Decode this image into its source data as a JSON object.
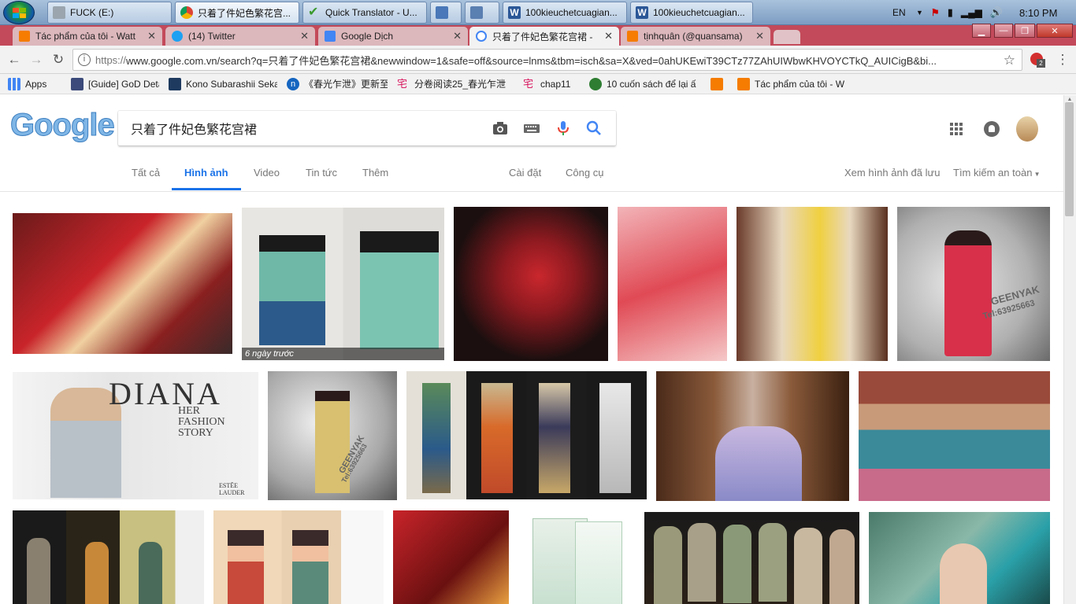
{
  "taskbar": {
    "items": [
      {
        "label": "FUCK (E:)",
        "icon": "drive-icon"
      },
      {
        "label": "只着了件妃色繁花宫...",
        "icon": "chrome-icon"
      },
      {
        "label": "Quick Translator - U...",
        "icon": "check-icon"
      },
      {
        "label": "",
        "icon": "keyboard-icon"
      },
      {
        "label": "",
        "icon": "network-window-icon"
      },
      {
        "label": "100kieuchetcuagian...",
        "icon": "word-icon"
      },
      {
        "label": "100kieuchetcuagian...",
        "icon": "word-icon"
      }
    ],
    "lang": "EN",
    "time": "8:10 PM"
  },
  "tabs": [
    {
      "title": "Tác phẩm của tôi - Watt",
      "icon": "wattpad-icon"
    },
    {
      "title": "(14) Twitter",
      "icon": "twitter-icon"
    },
    {
      "title": "Google Dịch",
      "icon": "google-translate-icon"
    },
    {
      "title": "只着了件妃色繁花宫裙 -",
      "icon": "google-icon"
    },
    {
      "title": "tịnhquân (@quansama)",
      "icon": "wattpad-icon"
    }
  ],
  "toolbar": {
    "url_scheme": "https://",
    "url_rest": "www.google.com.vn/search?q=只着了件妃色繁花宫裙&newwindow=1&safe=off&source=lnms&tbm=isch&sa=X&ved=0ahUKEwiT39CTz77ZAhUIWbwKHVOYCTkQ_AUICigB&bi...",
    "ext_badge": "2"
  },
  "bookmarks": [
    {
      "label": "Apps",
      "icon": "apps-grid-icon"
    },
    {
      "label": "[Guide] GoD Detailed",
      "icon": "guide-icon"
    },
    {
      "label": "Kono Subarashii Seka",
      "icon": "anime-icon"
    },
    {
      "label": "《春光乍泄》更新至",
      "icon": "n-icon"
    },
    {
      "label": "分卷阅读25_春光乍泄",
      "icon": "zhai-icon"
    },
    {
      "label": "chap11",
      "icon": "zhai-icon"
    },
    {
      "label": "10 cuốn sách để lại ấ",
      "icon": "green-circle-icon"
    },
    {
      "label": "",
      "icon": "wattpad-icon"
    },
    {
      "label": "Tác phẩm của tôi - W",
      "icon": "wattpad-icon"
    }
  ],
  "google": {
    "logo": "Google",
    "query": "只着了件妃色繁花宫裙",
    "nav": [
      "Tất cả",
      "Hình ảnh",
      "Video",
      "Tin tức",
      "Thêm"
    ],
    "tools": [
      "Cài đặt",
      "Công cụ"
    ],
    "saved": "Xem hình ảnh đã lưu",
    "safe": "Tìm kiếm an toàn"
  },
  "results": {
    "badge": "6 ngày trước",
    "diana_title": "DIANA",
    "diana_sub": "HER\nFASHION\nSTORY",
    "diana_brand": "ESTĒE LAUDER",
    "watermark": "GEENYAK",
    "watermark_tel": "Tel:63925663"
  }
}
